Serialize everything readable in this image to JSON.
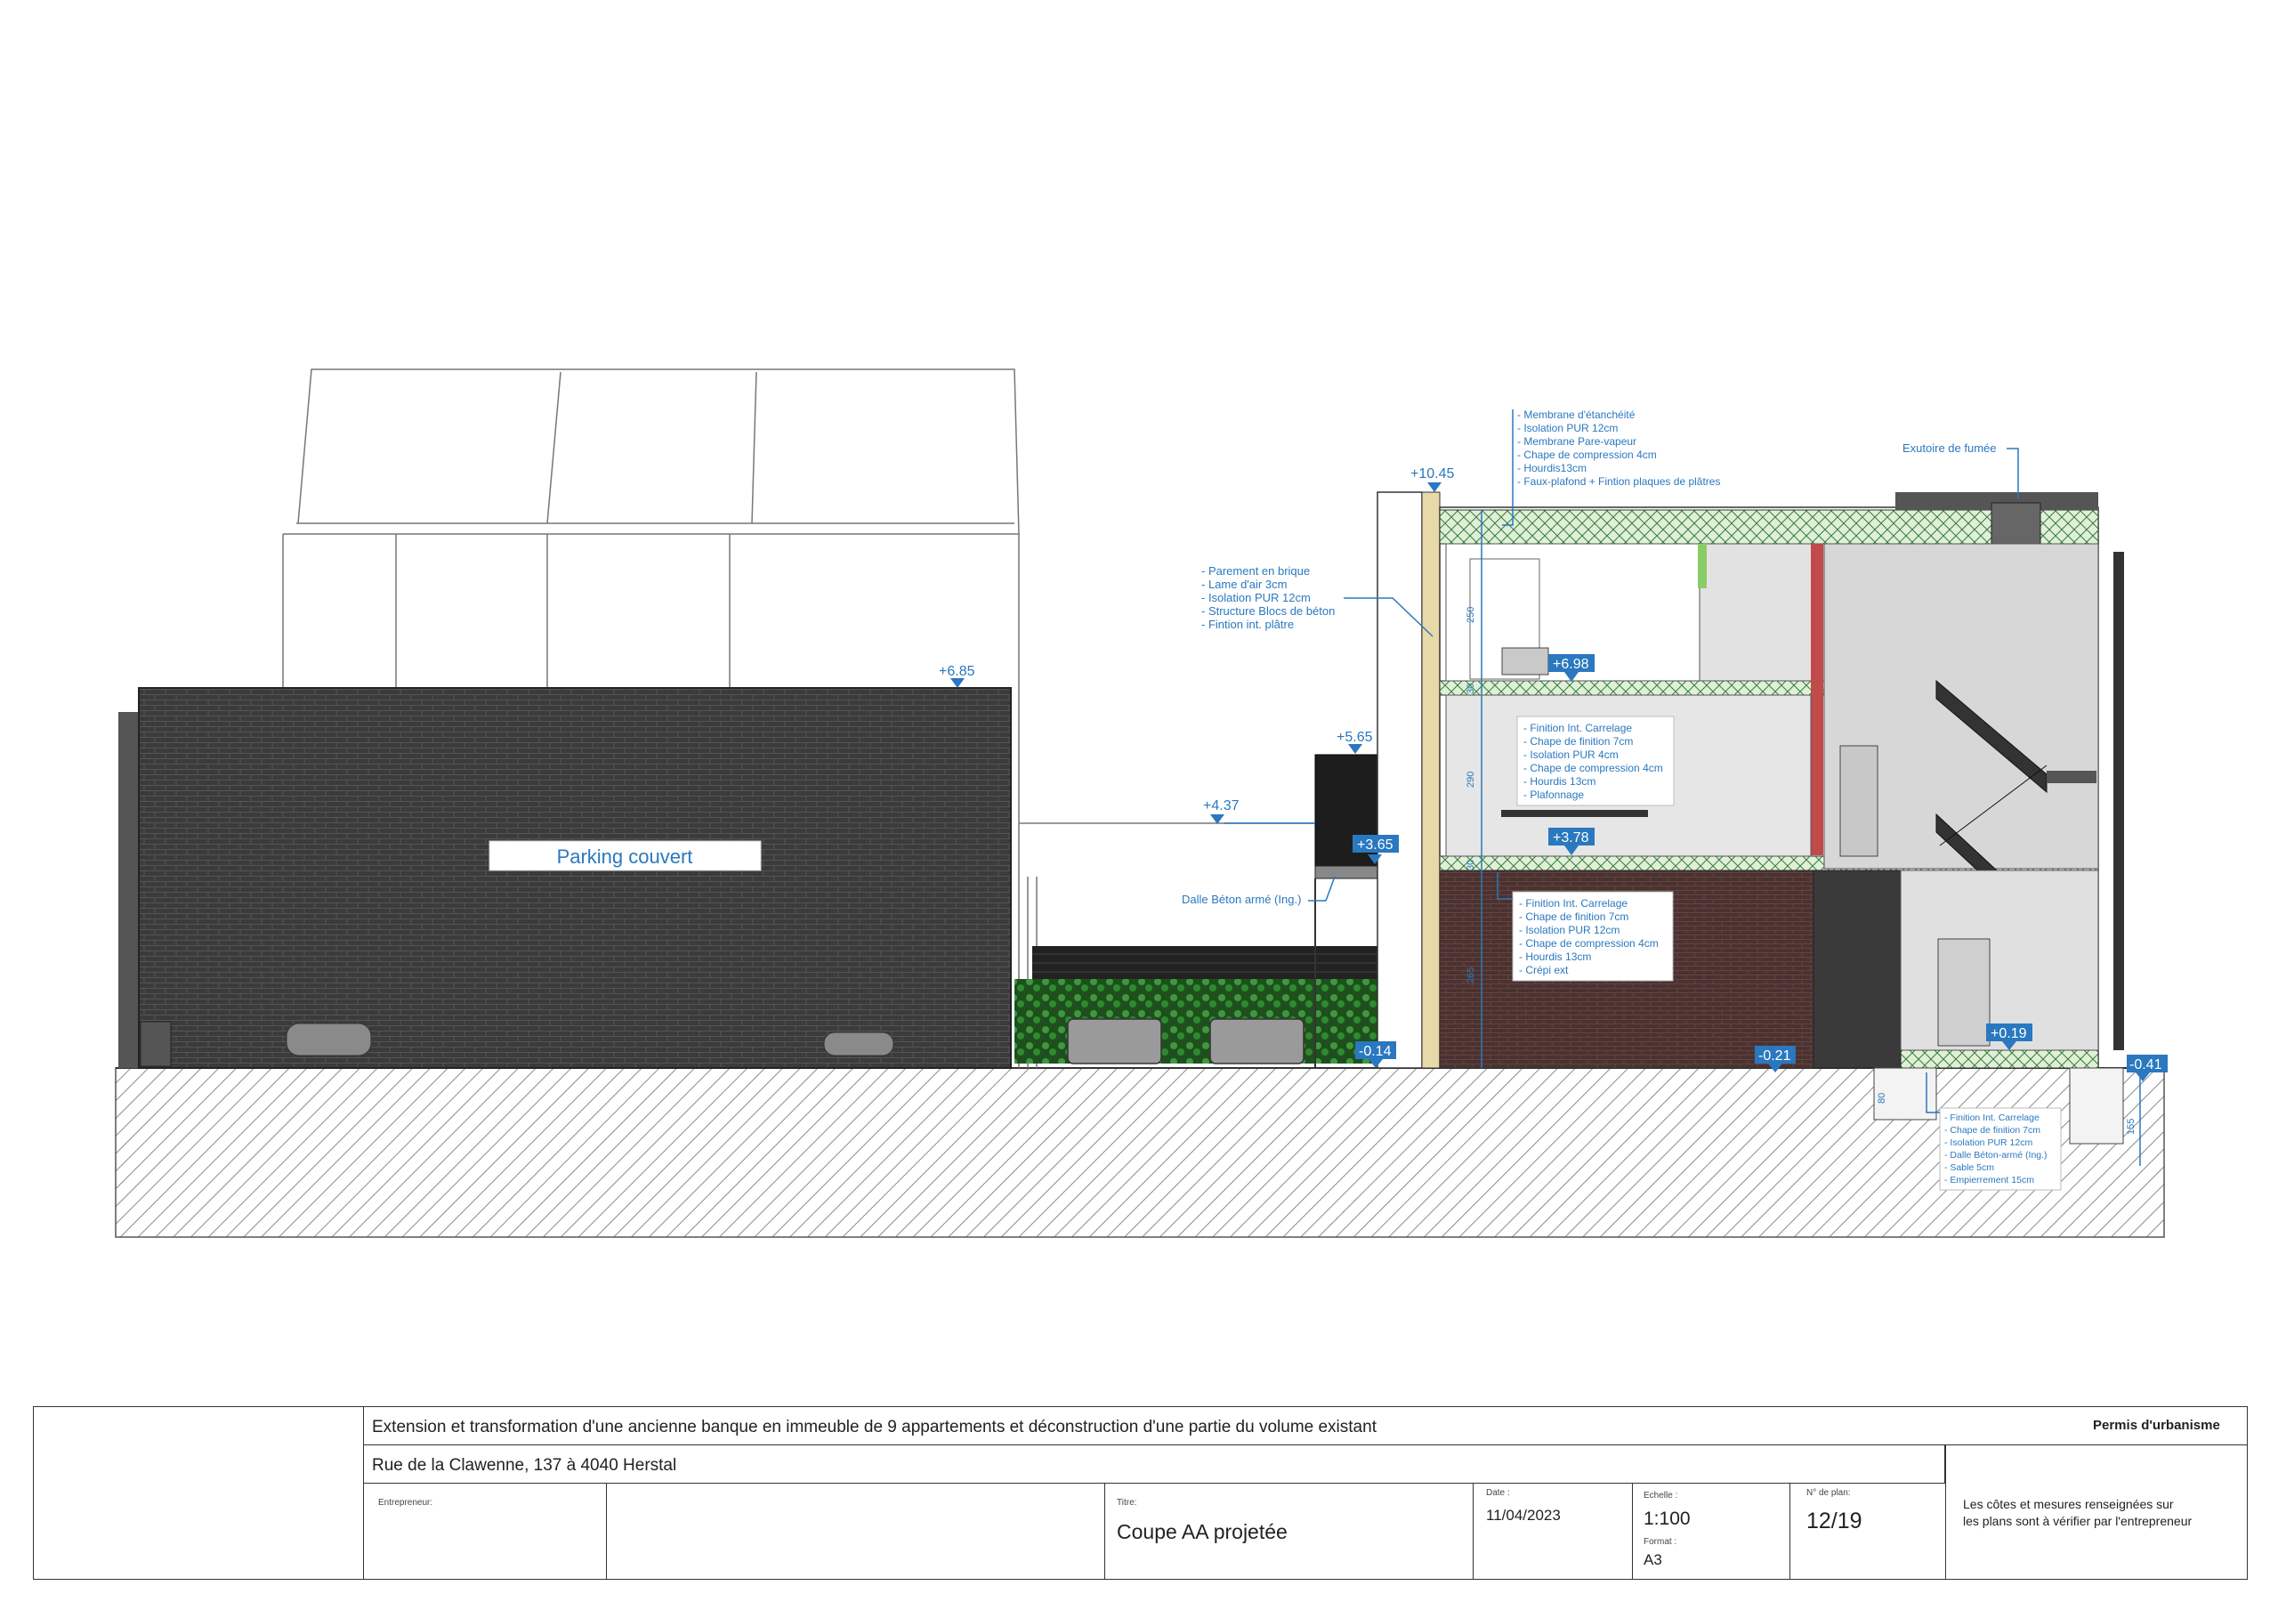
{
  "drawing": {
    "parking_label": "Parking couvert",
    "levels": {
      "l_685": "+6.85",
      "l_1045": "+10.45",
      "l_565": "+5.65",
      "l_437": "+4.37",
      "l_365": "+3.65",
      "l_698": "+6.98",
      "l_378": "+3.78",
      "l_m014": "-0.14",
      "l_m021": "-0.21",
      "l_019": "+0.19",
      "l_m041": "-0.41"
    },
    "dimensions": {
      "d_250": "250",
      "d_30a": "30",
      "d_290": "290",
      "d_30b": "30",
      "d_265": "265",
      "d_80": "80",
      "d_155": "155"
    },
    "roof_legend": [
      "- Membrane d'étanchéité",
      "- Isolation PUR 12cm",
      "- Membrane Pare-vapeur",
      "- Chape de compression 4cm",
      "- Hourdis13cm",
      "- Faux-plafond + Fintion plaques de plâtres"
    ],
    "wall_legend": [
      "- Parement en brique",
      "- Lame d'air 3cm",
      "- Isolation PUR 12cm",
      "- Structure Blocs de béton",
      "- Fintion int. plâtre"
    ],
    "floor1_legend": [
      "- Finition  Int. Carrelage",
      "- Chape de finition 7cm",
      "- Isolation PUR 4cm",
      "- Chape de compression 4cm",
      "- Hourdis 13cm",
      "- Plafonnage"
    ],
    "floor0_legend": [
      "- Finition  Int. Carrelage",
      "- Chape de finition 7cm",
      "- Isolation PUR 12cm",
      "- Chape de compression 4cm",
      "- Hourdis 13cm",
      "- Crépi ext"
    ],
    "slab_legend": [
      "- Finition  Int. Carrelage",
      "- Chape de finition 7cm",
      "- Isolation PUR 12cm",
      "- Dalle Béton-armé (Ing.)",
      "- Sable 5cm",
      "- Empierrement 15cm"
    ],
    "smoke_label": "Exutoire de fumée",
    "dalle_label": "Dalle Béton armé (Ing.)"
  },
  "title_block": {
    "project": "Extension et transformation d'une ancienne banque en immeuble de 9 appartements et déconstruction d'une partie du volume existant",
    "permit": "Permis d'urbanisme",
    "address": "Rue de la Clawenne, 137 à 4040 Herstal",
    "contractor_caption": "Entrepreneur:",
    "title_caption": "Titre:",
    "title": "Coupe AA projetée",
    "date_caption": "Date :",
    "date": "11/04/2023",
    "scale_caption": "Echelle :",
    "scale": "1:100",
    "format_caption": "Format :",
    "format": "A3",
    "plan_caption": "N° de plan:",
    "plan": "12/19",
    "note_line1": "Les côtes et mesures renseignées sur",
    "note_line2": "les plans sont à vérifier par l'entrepreneur"
  },
  "colors": {
    "annotation": "#2a78bf",
    "brick_dark": "#3a3a3a",
    "hedge": "#2f7a2f"
  }
}
